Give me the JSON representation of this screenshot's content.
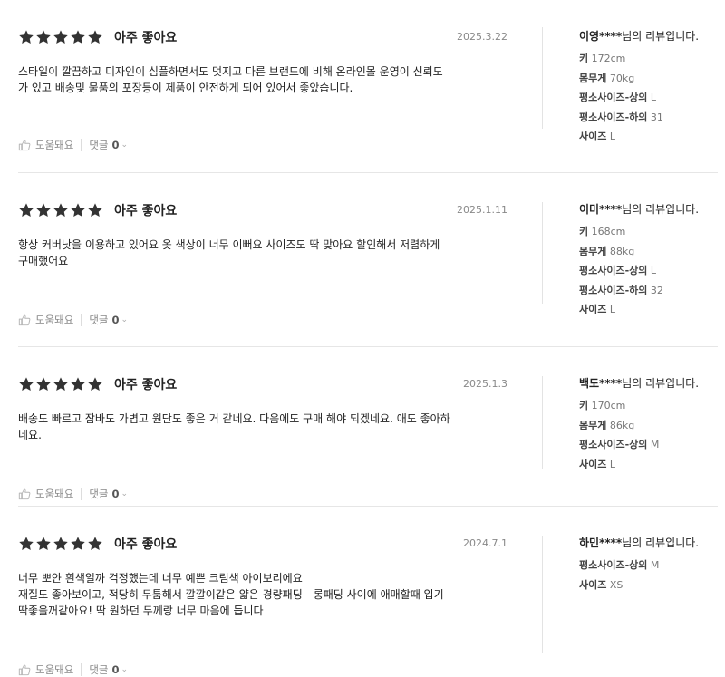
{
  "reviews": [
    {
      "stars": 5,
      "rating_label": "아주 좋아요",
      "date": "2025.3.22",
      "content": [
        "스타일이 깔끔하고 디자인이 심플하면서도 멋지고 다른 브랜드에 비해 온라인몰 운영이 신뢰도",
        "가 있고 배송및 물품의 포장등이 제품이 안전하게 되어 있어서 좋았습니다."
      ],
      "helpful_label": "도움돼요",
      "comment_label": "댓글",
      "comment_count": "0",
      "reviewer_name": "이영****",
      "reviewer_suffix": "님의 리뷰입니다.",
      "specs": [
        {
          "label": "키",
          "value": "172cm"
        },
        {
          "label": "몸무게",
          "value": "70kg"
        },
        {
          "label": "평소사이즈-상의",
          "value": "L"
        },
        {
          "label": "평소사이즈-하의",
          "value": "31"
        },
        {
          "label": "사이즈",
          "value": "L"
        }
      ]
    },
    {
      "stars": 5,
      "rating_label": "아주 좋아요",
      "date": "2025.1.11",
      "content": [
        "항상 커버낫을 이용하고 있어요 옷 색상이 너무 이뻐요 사이즈도 딱 맞아요 할인해서 저렴하게",
        "구매했어요"
      ],
      "helpful_label": "도움돼요",
      "comment_label": "댓글",
      "comment_count": "0",
      "reviewer_name": "이미****",
      "reviewer_suffix": "님의 리뷰입니다.",
      "specs": [
        {
          "label": "키",
          "value": "168cm"
        },
        {
          "label": "몸무게",
          "value": "88kg"
        },
        {
          "label": "평소사이즈-상의",
          "value": "L"
        },
        {
          "label": "평소사이즈-하의",
          "value": "32"
        },
        {
          "label": "사이즈",
          "value": "L"
        }
      ]
    },
    {
      "stars": 5,
      "rating_label": "아주 좋아요",
      "date": "2025.1.3",
      "content": [
        "배송도 빠르고 잠바도 가볍고 원단도 좋은 거 같네요. 다음에도 구매 해야 되겠네요. 애도 좋아하",
        "네요."
      ],
      "helpful_label": "도움돼요",
      "comment_label": "댓글",
      "comment_count": "0",
      "reviewer_name": "백도****",
      "reviewer_suffix": "님의 리뷰입니다.",
      "specs": [
        {
          "label": "키",
          "value": "170cm"
        },
        {
          "label": "몸무게",
          "value": "86kg"
        },
        {
          "label": "평소사이즈-상의",
          "value": "M"
        },
        {
          "label": "사이즈",
          "value": "L"
        }
      ]
    },
    {
      "stars": 5,
      "rating_label": "아주 좋아요",
      "date": "2024.7.1",
      "content": [
        "너무 뽀얀 흰색일까 걱정했는데 너무 예쁜 크림색 아이보리에요",
        "재질도 좋아보이고, 적당히 두툼해서 깔깔이같은 얇은 경량패딩 - 롱패딩 사이에 애매할때 입기",
        "딱좋을꺼같아요! 딱 원하던 두께랑 너무 마음에 듭니다"
      ],
      "helpful_label": "도움돼요",
      "comment_label": "댓글",
      "comment_count": "0",
      "reviewer_name": "하민****",
      "reviewer_suffix": "님의 리뷰입니다.",
      "specs": [
        {
          "label": "평소사이즈-상의",
          "value": "M"
        },
        {
          "label": "사이즈",
          "value": "XS"
        }
      ]
    }
  ]
}
